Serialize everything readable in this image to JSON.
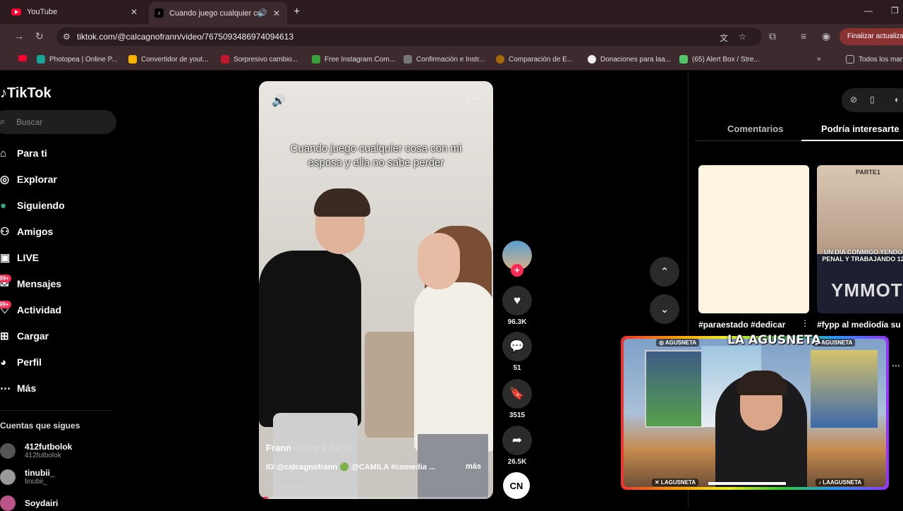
{
  "browser": {
    "tabs": [
      {
        "title": "YouTube",
        "active": false
      },
      {
        "title": "Cuando juego cualquier co",
        "active": true
      }
    ],
    "url": "tiktok.com/@calcagnofrann/video/7675093486974094613",
    "update_button": "Finalizar actualiza",
    "bookmarks": [
      {
        "label": "Photopea | Online P...",
        "color": "#18a497"
      },
      {
        "label": "Convertidor de yout...",
        "color": "#f5b400"
      },
      {
        "label": "Sorpresivo cambio...",
        "color": "#c0182c"
      },
      {
        "label": "Free Instagram Com...",
        "color": "#3aa13a"
      },
      {
        "label": "Confirmación e Instr...",
        "color": "#777777"
      },
      {
        "label": "Comparación de E...",
        "color": "#a86a00"
      },
      {
        "label": "Donaciones para laa...",
        "color": "#eeeeee"
      },
      {
        "label": "(65) Alert Box / Stre...",
        "color": "#53c66a"
      },
      {
        "label": "Todos los mar",
        "color": "#bbbbbb"
      }
    ]
  },
  "tiktok": {
    "logo": "TikTok",
    "search_placeholder": "Buscar",
    "nav": [
      {
        "label": "Para ti",
        "icon": "home-icon"
      },
      {
        "label": "Explorar",
        "icon": "compass-icon"
      },
      {
        "label": "Siguiendo",
        "icon": "following-icon"
      },
      {
        "label": "Amigos",
        "icon": "friends-icon"
      },
      {
        "label": "LIVE",
        "icon": "live-icon"
      },
      {
        "label": "Mensajes",
        "icon": "messages-icon",
        "badge": "99+"
      },
      {
        "label": "Actividad",
        "icon": "activity-icon",
        "badge": "99+"
      },
      {
        "label": "Cargar",
        "icon": "upload-icon"
      },
      {
        "label": "Perfil",
        "icon": "profile-icon"
      },
      {
        "label": "Más",
        "icon": "more-icon"
      }
    ],
    "following_title": "Cuentas que sigues",
    "following": [
      {
        "name": "412futbolok",
        "handle": "412futbolok"
      },
      {
        "name": "tinubii_",
        "handle": "tinubii_"
      },
      {
        "name": "Soydairi",
        "handle": ""
      }
    ]
  },
  "video": {
    "caption": "Cuando juego cualquier cosa con mi esposa y ella no sabe perder",
    "author": "Frann",
    "time": "· Hace 2 día(s)",
    "description": "IG:@calcagnofrann 🟢 @CAMILA #comedia ...",
    "more": "más",
    "translate": "Ver traducción",
    "progress": 0.04,
    "likes": "96.3K",
    "comments": "51",
    "saves": "3515",
    "shares": "26.5K",
    "music_badge": "CN"
  },
  "right_panel": {
    "tabs": [
      "Comentarios",
      "Podría interesarte"
    ],
    "active_tab": "Podría interesarte",
    "thumb1_caption": "#paraestado #dedicar",
    "thumb2_caption": "#fypp al mediodía su",
    "thumb2_text": "UN DIA CONMIGO YENDO PENAL Y TRABAJANDO 12",
    "thumb2_part": "PARTE1",
    "thumb2_brand": "YMMOT"
  },
  "stream": {
    "logo": "LA AGUSNETA",
    "tag_top_left": "◎ AGUSNETA",
    "tag_top_right": "▶ AGUSNETA",
    "tag_bottom_left": "✕ LAGUSNETA",
    "tag_bottom_right": "♪ LAAGUSNETA"
  }
}
